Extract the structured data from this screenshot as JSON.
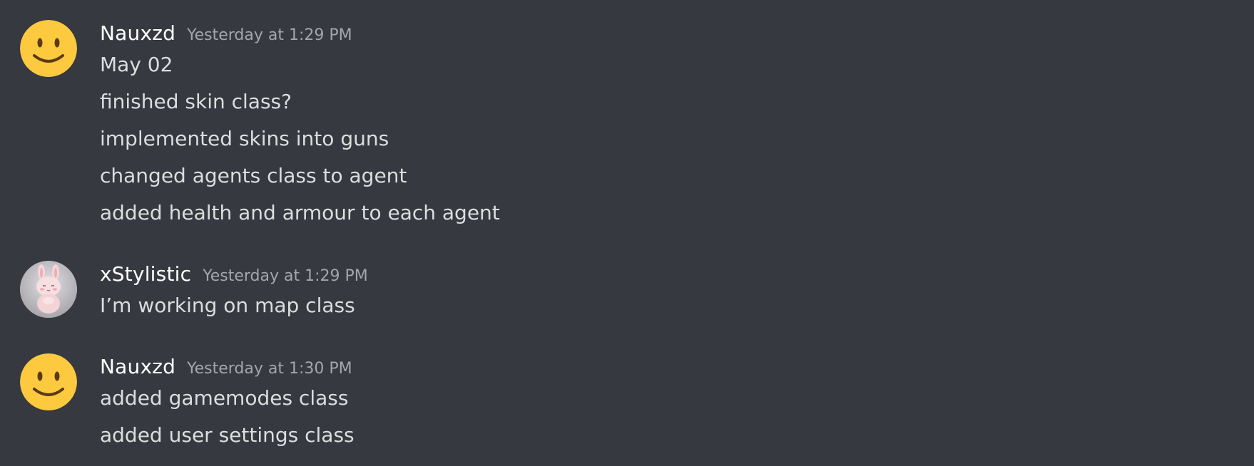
{
  "messages": [
    {
      "author": "Nauxzd",
      "timestamp": "Yesterday at 1:29 PM",
      "avatar_icon": "smiley-face-icon",
      "lines": [
        "May 02",
        "finished skin class?",
        "implemented skins into guns",
        "changed agents class to agent",
        "added health and armour to each agent"
      ]
    },
    {
      "author": "xStylistic",
      "timestamp": "Yesterday at 1:29 PM",
      "avatar_icon": "bunny-avatar-icon",
      "lines": [
        "I’m working on map class"
      ]
    },
    {
      "author": "Nauxzd",
      "timestamp": "Yesterday at 1:30 PM",
      "avatar_icon": "smiley-face-icon",
      "lines": [
        "added gamemodes class",
        "added user settings class"
      ]
    }
  ],
  "colors": {
    "background": "#36393f",
    "username": "#ffffff",
    "timestamp": "#a3a6aa",
    "message_text": "#dcddde",
    "smiley_face": "#fcc93f"
  }
}
